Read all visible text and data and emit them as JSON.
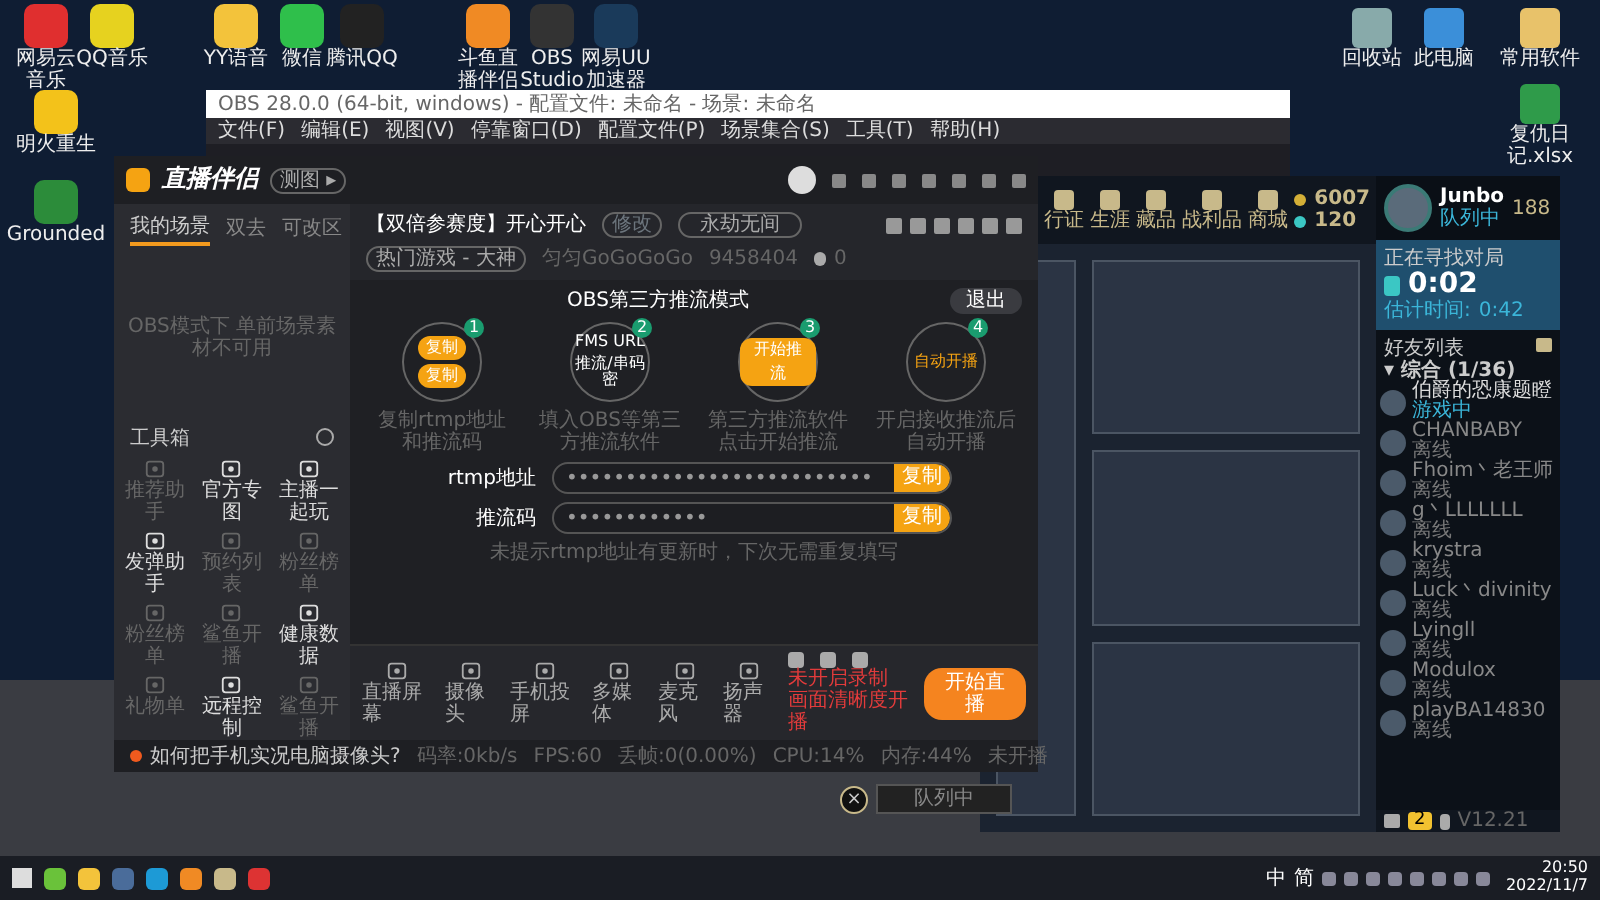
{
  "desktop_top_icons": [
    {
      "label": "网易云音乐"
    },
    {
      "label": "QQ音乐"
    },
    {
      "label": "YY语音"
    },
    {
      "label": "微信"
    },
    {
      "label": "腾讯QQ"
    },
    {
      "label": "斗鱼直播伴侣"
    },
    {
      "label": "OBS Studio"
    },
    {
      "label": "网易UU加速器"
    }
  ],
  "desktop_left_icons": [
    {
      "label": "明火重生"
    },
    {
      "label": "Grounded"
    }
  ],
  "desktop_right_icons": [
    {
      "label": "回收站"
    },
    {
      "label": "此电脑"
    },
    {
      "label": "常用软件"
    },
    {
      "label": "复仇日记.xlsx"
    }
  ],
  "obs_window": {
    "title": "OBS 28.0.0 (64-bit, windows) - 配置文件: 未命名 - 场景: 未命名",
    "menu": [
      "文件(F)",
      "编辑(E)",
      "视图(V)",
      "停靠窗口(D)",
      "配置文件(P)",
      "场景集合(S)",
      "工具(T)",
      "帮助(H)"
    ]
  },
  "game_client": {
    "nav": [
      "行证",
      "生涯",
      "藏品",
      "战利品",
      "商城"
    ],
    "currency": [
      "6007",
      "120"
    ],
    "profile": {
      "name": "Junbo",
      "status": "队列中",
      "level": "188"
    },
    "queue": {
      "title": "正在寻找对局",
      "timer": "0:02",
      "estimate_label": "估计时间:",
      "estimate": "0:42"
    },
    "friends_title": "好友列表",
    "group": "▾ 综合 (1/36)",
    "friends": [
      {
        "name": "伯爵的恐康题瞪",
        "status": "游戏中",
        "online": true
      },
      {
        "name": "CHANBABY",
        "status": "离线",
        "online": false
      },
      {
        "name": "Fhoim丶老王师",
        "status": "离线",
        "online": false
      },
      {
        "name": "g丶LLLLLLL",
        "status": "离线",
        "online": false
      },
      {
        "name": "krystra",
        "status": "离线",
        "online": false
      },
      {
        "name": "Luck丶divinity",
        "status": "离线",
        "online": false
      },
      {
        "name": "Lyingll",
        "status": "离线",
        "online": false
      },
      {
        "name": "Modulox",
        "status": "离线",
        "online": false
      },
      {
        "name": "playBA14830",
        "status": "离线",
        "online": false
      }
    ],
    "footer_badge": "2",
    "version": "V12.21"
  },
  "streamer_app": {
    "logo": "直播伴侣",
    "mode_chip": "测图 ▸",
    "tabs": [
      {
        "label": "我的场景",
        "selected": true
      },
      {
        "label": "双去",
        "selected": false
      },
      {
        "label": "可改区",
        "selected": false
      }
    ],
    "empty_message": "OBS模式下 单前场景素材不可用",
    "toolbox_title": "工具箱",
    "tools": [
      {
        "label": "推荐助手",
        "enabled": false
      },
      {
        "label": "官方专图",
        "enabled": true
      },
      {
        "label": "主播一起玩",
        "enabled": true
      },
      {
        "label": "发弹助手",
        "enabled": true
      },
      {
        "label": "预约列表",
        "enabled": false
      },
      {
        "label": "粉丝榜单",
        "enabled": false
      },
      {
        "label": "粉丝榜单",
        "enabled": false
      },
      {
        "label": "鲨鱼开播",
        "enabled": false
      },
      {
        "label": "健康数据",
        "enabled": true
      },
      {
        "label": "礼物单",
        "enabled": false
      },
      {
        "label": "远程控制",
        "enabled": true
      },
      {
        "label": "鲨鱼开播",
        "enabled": false
      }
    ],
    "tip": "如何把手机实况电脑摄像头?",
    "room_title": "【双倍参赛度】开心开心",
    "edit_button": "修改",
    "game_field": "永劫无间",
    "category": "热门游戏 - 大神",
    "nickname": "匀匀GoGoGoGo",
    "room_id": "9458404",
    "heat": "0",
    "mode_title": "OBS第三方推流模式",
    "exit_button": "退出",
    "steps": [
      {
        "number": "1",
        "kind": "copy",
        "texts": [
          "复制",
          "复制"
        ],
        "caption": "复制rtmp地址和推流码"
      },
      {
        "number": "2",
        "kind": "fields",
        "texts": [
          "FMS URL",
          "推流/串码密"
        ],
        "caption": "填入OBS等第三方推流软件"
      },
      {
        "number": "3",
        "kind": "button",
        "texts": [
          "开始推流"
        ],
        "caption": "第三方推流软件点击开始推流"
      },
      {
        "number": "4",
        "kind": "text",
        "texts": [
          "自动开播"
        ],
        "caption": "开启接收推流后自动开播"
      }
    ],
    "fields": [
      {
        "label": "rtmp地址",
        "value": "••••••••••••••••••••••••••",
        "button": "复制"
      },
      {
        "label": "推流码",
        "value": "••••••••••••",
        "button": "复制"
      }
    ],
    "hint": "未提示rtmp地址有更新时，下次无需重复填写",
    "toolbar": [
      "直播屏幕",
      "摄像头",
      "手机投屏",
      "多媒体",
      "麦克风",
      "扬声器"
    ],
    "warnings": [
      "未开启录制",
      "画面清晰度开播"
    ],
    "start_button": "开始直播",
    "stats": [
      "码率:0kb/s",
      "FPS:60",
      "丢帧:0(0.00%)",
      "CPU:14%",
      "内存:44%",
      "未开播"
    ]
  },
  "queue_bar": {
    "close": "×",
    "status": "队列中"
  },
  "taskbar": {
    "tray": [
      "中",
      "简"
    ],
    "time": "20:50",
    "date": "2022/11/7"
  }
}
